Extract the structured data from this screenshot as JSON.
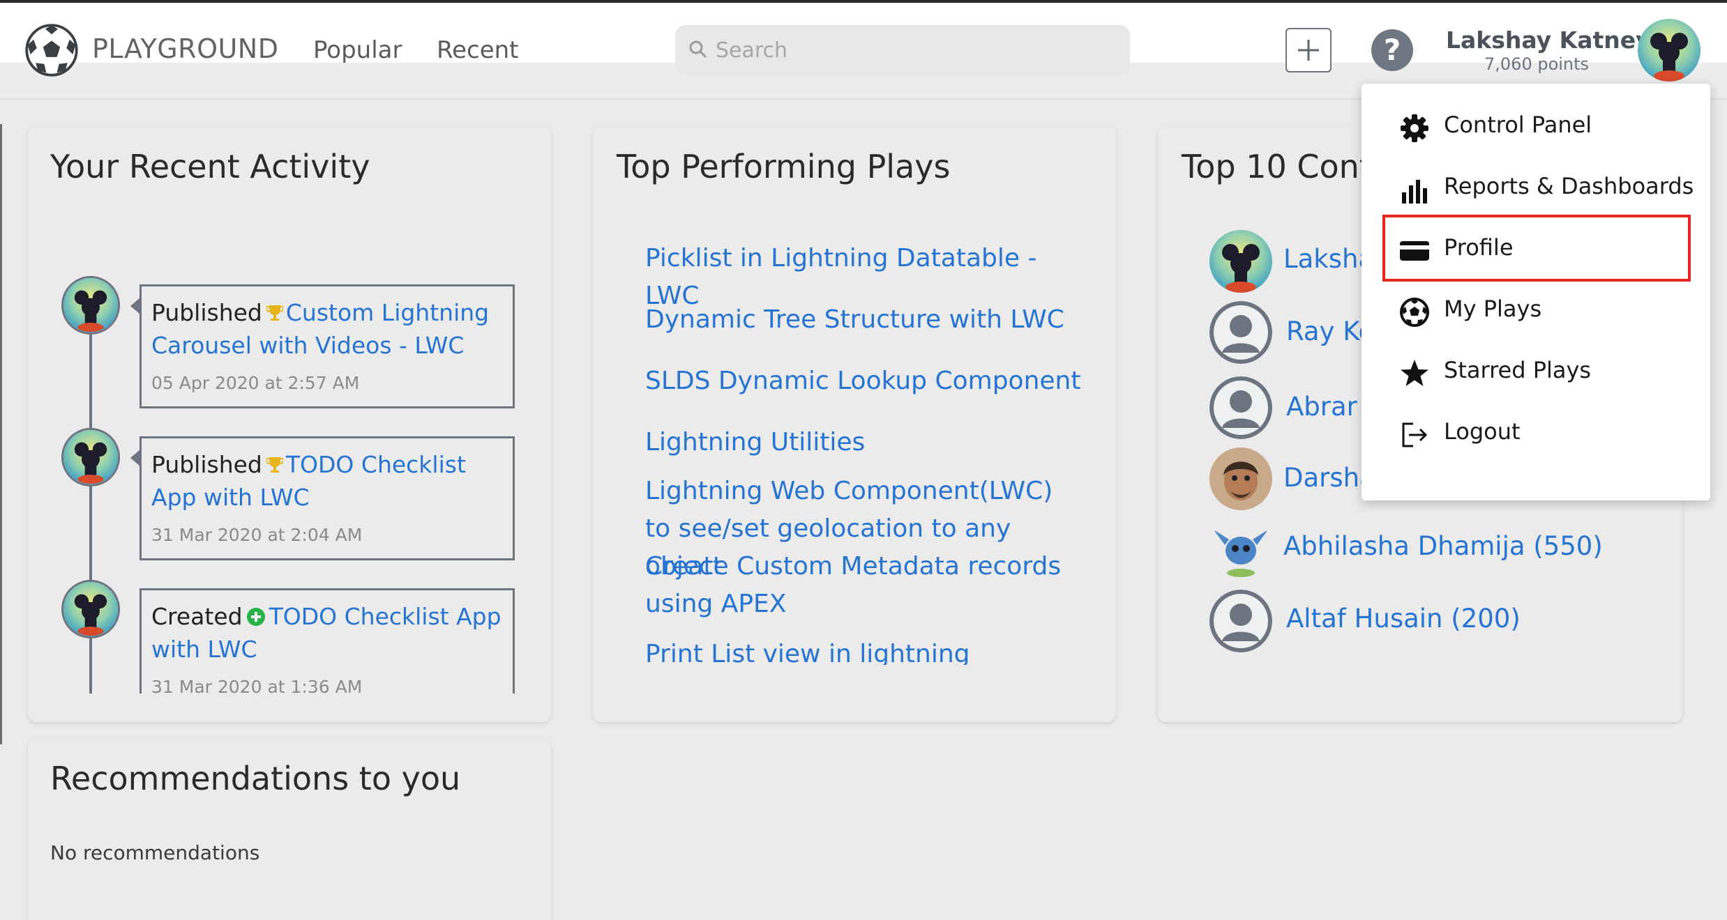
{
  "header": {
    "brand": "PLAYGROUND",
    "nav": [
      "Popular",
      "Recent"
    ],
    "search_placeholder": "Search",
    "help_glyph": "?",
    "user_name": "Lakshay Katney",
    "user_points": "7,060 points"
  },
  "recent_activity": {
    "title": "Your Recent Activity",
    "items": [
      {
        "action": "Published",
        "icon": "trophy-icon",
        "link": "Custom Lightning Carousel with Videos - LWC",
        "date": "05 Apr 2020 at 2:57 AM"
      },
      {
        "action": "Published",
        "icon": "trophy-icon",
        "link": "TODO Checklist App with LWC",
        "date": "31 Mar 2020 at 2:04 AM"
      },
      {
        "action": "Created",
        "icon": "plus-circle-icon",
        "link": "TODO Checklist App with LWC",
        "date": "31 Mar 2020 at 1:36 AM"
      }
    ]
  },
  "top_plays": {
    "title": "Top Performing Plays",
    "items": [
      "Picklist in Lightning Datatable - LWC",
      "Dynamic Tree Structure with LWC",
      "SLDS Dynamic Lookup Component",
      "Lightning Utilities",
      "Lightning Web Component(LWC) to see/set geolocation to any object",
      "Create Custom Metadata records using APEX",
      "Print List view in lightning"
    ]
  },
  "top_contributors": {
    "title": "Top 10 Cont",
    "items": [
      "Laksha",
      "Ray Ko",
      "Abrar",
      "Darsha",
      "Abhilasha Dhamija (550)",
      "Altaf Husain (200)"
    ]
  },
  "recommendations": {
    "title": "Recommendations to you",
    "empty_text": "No recommendations"
  },
  "user_menu": {
    "items": [
      {
        "label": "Control Panel",
        "icon": "gear-icon"
      },
      {
        "label": "Reports & Dashboards",
        "icon": "bar-chart-icon"
      },
      {
        "label": "Profile",
        "icon": "credit-card-icon"
      },
      {
        "label": "My Plays",
        "icon": "soccer-ball-icon"
      },
      {
        "label": "Starred Plays",
        "icon": "star-icon"
      },
      {
        "label": "Logout",
        "icon": "logout-icon"
      }
    ]
  },
  "colors": {
    "link": "#2574d4",
    "highlight": "#e5251f",
    "accent_gray": "#6b7480"
  }
}
